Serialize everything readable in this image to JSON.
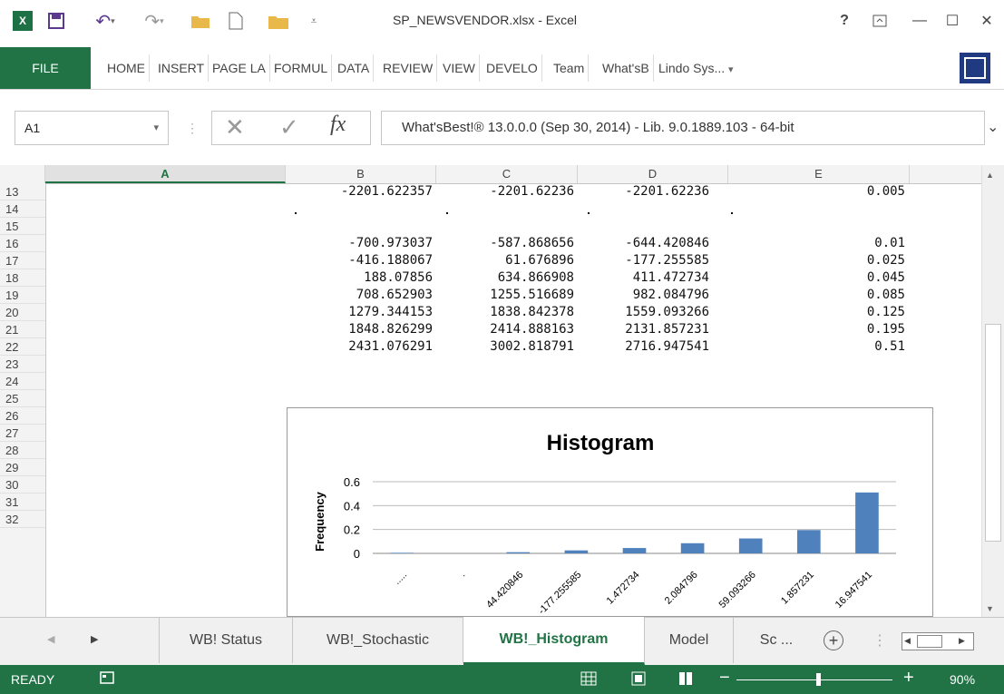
{
  "window": {
    "title": "SP_NEWSVENDOR.xlsx - Excel",
    "help": "?",
    "min": "—",
    "max": "☐",
    "close": "✕"
  },
  "ribbon": {
    "file": "FILE",
    "tabs": [
      "HOME",
      "INSERT",
      "PAGE LA",
      "FORMUL",
      "DATA",
      "REVIEW",
      "VIEW",
      "DEVELO",
      "Team",
      "What'sB"
    ],
    "account": "Lindo Sys...",
    "account_caret": "▾"
  },
  "formula_bar": {
    "name_box": "A1",
    "name_caret": "▾",
    "cancel": "✕",
    "enter": "✓",
    "fx": "fx",
    "formula": "What'sBest!® 13.0.0.0 (Sep 30, 2014) - Lib. 9.0.1889.103 - 64-bit",
    "expand": "⌄"
  },
  "grid": {
    "columns": [
      "A",
      "B",
      "C",
      "D",
      "E"
    ],
    "rows": [
      "13",
      "14",
      "15",
      "16",
      "17",
      "18",
      "19",
      "20",
      "21",
      "22",
      "23",
      "24",
      "25",
      "26",
      "27",
      "28",
      "29",
      "30",
      "31",
      "32"
    ],
    "data": [
      {
        "row": "13",
        "B": "-2201.622357",
        "C": "-2201.62236",
        "D": "-2201.62236",
        "E": "0.005"
      },
      {
        "row": "15",
        "B": "-700.973037",
        "C": "-587.868656",
        "D": "-644.420846",
        "E": "0.01"
      },
      {
        "row": "16",
        "B": "-416.188067",
        "C": "61.676896",
        "D": "-177.255585",
        "E": "0.025"
      },
      {
        "row": "17",
        "B": "188.07856",
        "C": "634.866908",
        "D": "411.472734",
        "E": "0.045"
      },
      {
        "row": "18",
        "B": "708.652903",
        "C": "1255.516689",
        "D": "982.084796",
        "E": "0.085"
      },
      {
        "row": "19",
        "B": "1279.344153",
        "C": "1838.842378",
        "D": "1559.093266",
        "E": "0.125"
      },
      {
        "row": "20",
        "B": "1848.826299",
        "C": "2414.888163",
        "D": "2131.857231",
        "E": "0.195"
      },
      {
        "row": "21",
        "B": "2431.076291",
        "C": "3002.818791",
        "D": "2716.947541",
        "E": "0.51"
      }
    ]
  },
  "chart_data": {
    "type": "bar",
    "title": "Histogram",
    "ylabel": "Frequency",
    "xlabel": "",
    "categories": [
      "-2201.62236",
      ".",
      "-644.420846",
      "-177.255585",
      "411.472734",
      "982.084796",
      "1559.093266",
      "2131.857231",
      "2716.947541"
    ],
    "tick_labels": [
      ".....",
      ".",
      "44.420846",
      "-177.255585",
      "1.472734",
      "2.084796",
      "59.093266",
      "1.857231",
      "16.947541"
    ],
    "values": [
      0.005,
      0,
      0.01,
      0.025,
      0.045,
      0.085,
      0.125,
      0.195,
      0.51
    ],
    "yticks": [
      "0.6",
      "0.4",
      "0.2",
      "0"
    ],
    "ylim": [
      0,
      0.6
    ],
    "grid": true,
    "legend": "none",
    "bar_color": "#4f81bd"
  },
  "sheet_tabs": {
    "tabs": [
      "WB! Status",
      "WB!_Stochastic",
      "WB!_Histogram",
      "Model",
      "Sc ..."
    ],
    "active": "WB!_Histogram",
    "add": "+"
  },
  "status_bar": {
    "status": "READY",
    "zoom": "90%",
    "minus": "−",
    "plus": "+"
  },
  "colors": {
    "excel_green": "#217346",
    "bar_blue": "#4f81bd"
  }
}
